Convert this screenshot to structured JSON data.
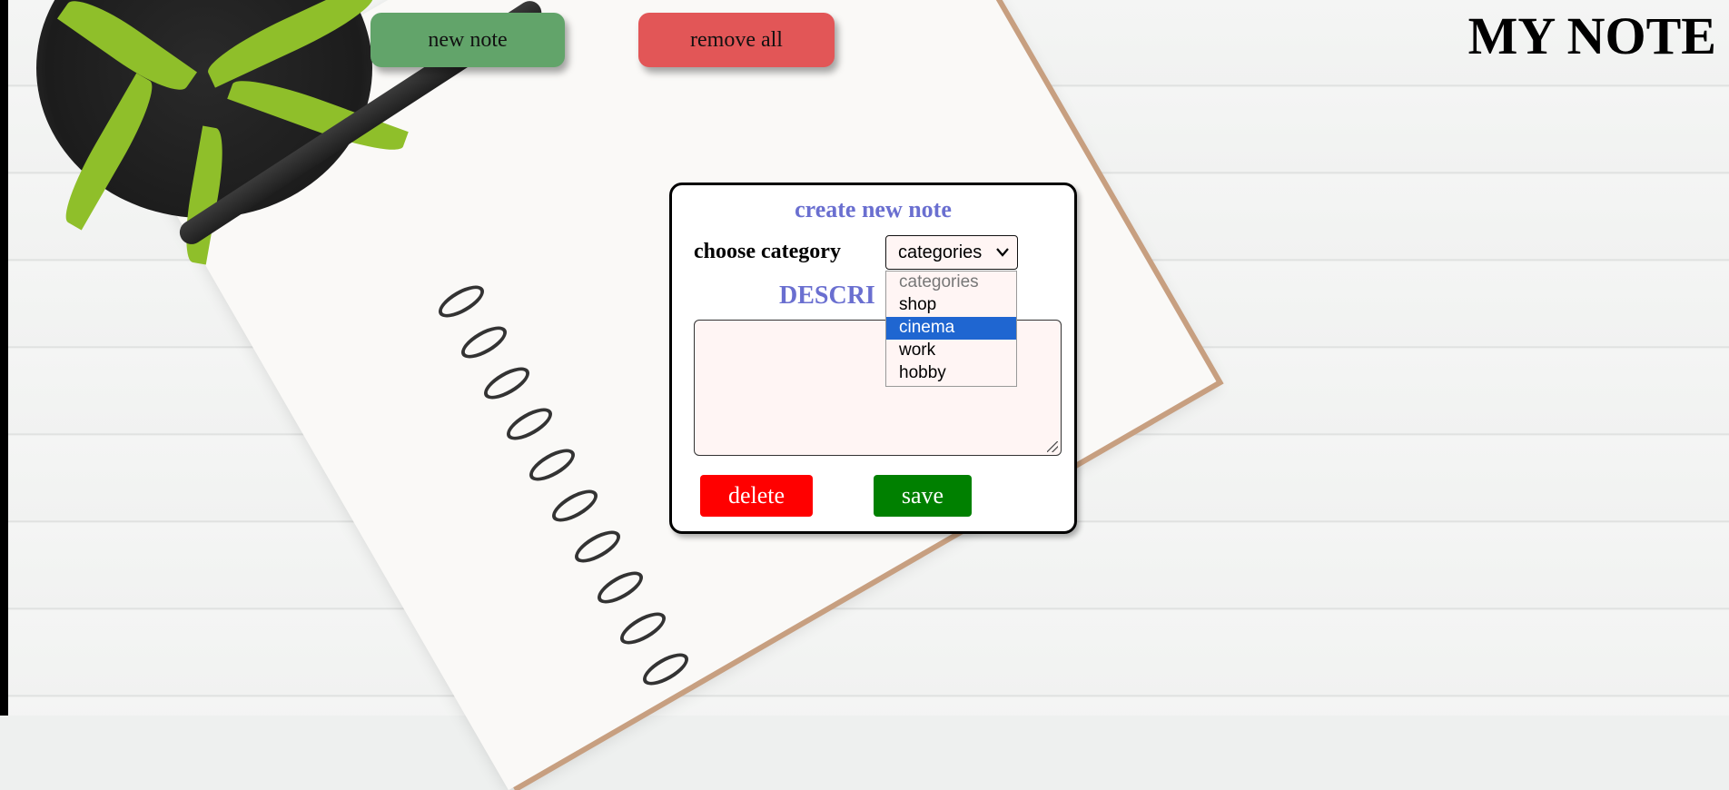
{
  "header": {
    "new_note_label": "new note",
    "remove_all_label": "remove all",
    "title": "MY NOTE"
  },
  "modal": {
    "title": "create new note",
    "choose_category_label": "choose category",
    "category_select": {
      "selected": "categories",
      "options": [
        "categories",
        "shop",
        "cinema",
        "work",
        "hobby"
      ],
      "highlighted": "cinema"
    },
    "description_label": "DESCRI",
    "description_value": "",
    "delete_label": "delete",
    "save_label": "save"
  },
  "colors": {
    "new_note_btn": "#62a46a",
    "remove_all_btn": "#e25657",
    "modal_title": "#6a6fd0",
    "delete_btn": "#ff0000",
    "save_btn": "#008000",
    "option_highlight": "#1f66d1"
  },
  "icons": {
    "select_arrow": "chevron-down-icon"
  }
}
